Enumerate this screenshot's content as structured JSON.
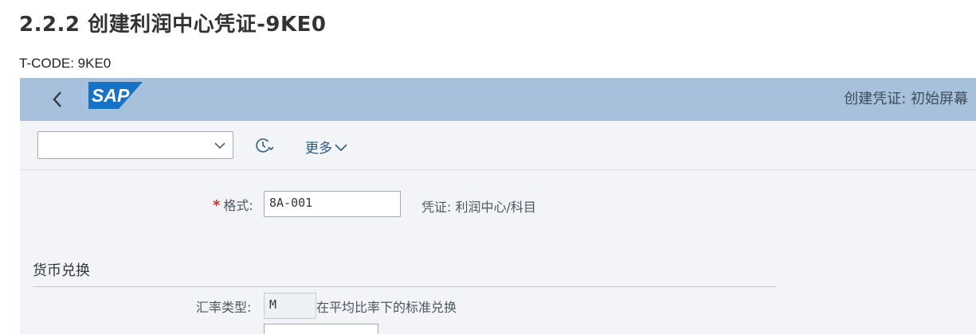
{
  "document": {
    "heading": "2.2.2 创建利润中心凭证-9KE0",
    "tcode": "T-CODE: 9KE0"
  },
  "shell": {
    "logo_text": "SAP",
    "title": "创建凭证: 初始屏幕"
  },
  "toolbar": {
    "dropdown_value": "",
    "more_label": "更多"
  },
  "form": {
    "layout": {
      "label": "格式:",
      "value": "8A-001",
      "description": "凭证: 利润中心/科目"
    },
    "currency_section": {
      "title": "货币兑换",
      "exchange_rate_type": {
        "label": "汇率类型:",
        "value": "M",
        "description": "在平均比率下的标准兑换"
      },
      "next_field": {
        "label": "",
        "value": ""
      }
    }
  },
  "colors": {
    "shell_bar": "#a7c1dc",
    "background": "#f2f4f7",
    "link": "#2e5a86",
    "required": "#c0392b"
  }
}
